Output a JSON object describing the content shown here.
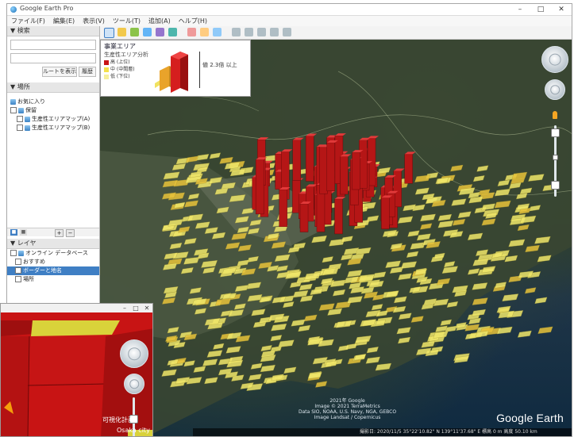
{
  "window": {
    "title": "Google Earth Pro",
    "controls": [
      "–",
      "□",
      "✕"
    ]
  },
  "menu": [
    "ファイル(F)",
    "編集(E)",
    "表示(V)",
    "ツール(T)",
    "追加(A)",
    "ヘルプ(H)"
  ],
  "sidebar": {
    "search_header": "▼ 検索",
    "search_buttons": [
      "ルートを表示",
      "履歴"
    ],
    "places_header": "▼ 場所",
    "places": [
      "お気に入り",
      "保留",
      "生産性エリアマップ(A)",
      "生産性エリアマップ(B)"
    ],
    "mini_buttons": [
      "■",
      "■",
      "+",
      "−"
    ],
    "layers_header": "▼ レイヤ",
    "layers": [
      "オンライン データベース",
      "おすすめ",
      "ボーダーと地名",
      "場所"
    ]
  },
  "popup": {
    "title": "事業エリア",
    "subtitle": "生産性エリア分析",
    "legend": [
      {
        "label": "高 (上位)",
        "color": "#c81414"
      },
      {
        "label": "中 (中間層)",
        "color": "#f4e04a"
      },
      {
        "label": "低 (下位)",
        "color": "#f6ef9a"
      }
    ],
    "dimension_label": "値 2.3倍 以上"
  },
  "map": {
    "center_caption": [
      "2021年 Google",
      "Image © 2021 TerraMetrics",
      "Data SIO, NOAA, U.S. Navy, NGA, GEBCO",
      "Image Landsat / Copernicus"
    ],
    "logo": "Google Earth",
    "status": "撮影日: 2020/11/5    35°22'10.82\" N  139°11'37.68\" E   標高 0 m    高度 50.10 km"
  },
  "inset": {
    "controls": [
      "–",
      "□",
      "✕"
    ],
    "caption_1": "可視化計画",
    "caption_2": "Osaka city"
  },
  "colors": {
    "high": "#c81414",
    "mid": "#f4e04a",
    "low": "#f6ef9a",
    "sea": "#0f2a40"
  }
}
